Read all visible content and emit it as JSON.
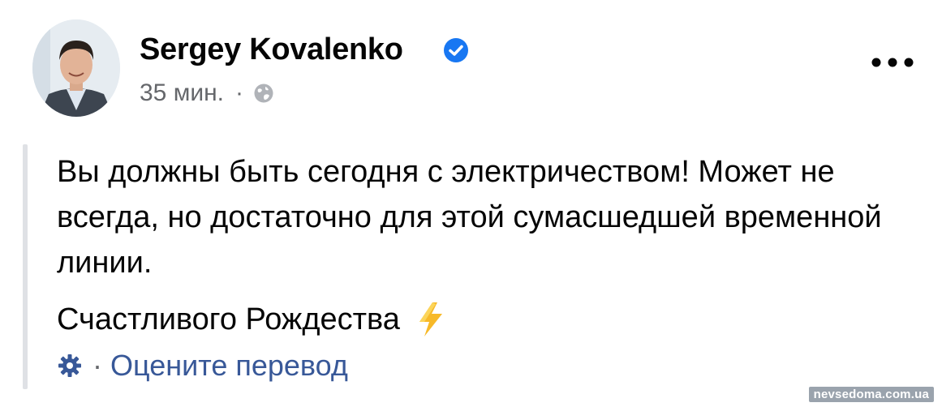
{
  "post": {
    "author": {
      "name": "Sergey Kovalenko",
      "verified": true
    },
    "timestamp": "35 мин.",
    "meta_separator": "·",
    "audience_icon": "globe-icon",
    "more_icon": "more-horizontal-icon",
    "body": {
      "paragraph_1": "Вы должны быть сегодня с электричеством! Может не всегда, но достаточно для этой сумасшедшей временной линии.",
      "paragraph_2": "Счастливого Рождества",
      "emoji": "lightning-bolt-icon"
    },
    "translation": {
      "icon": "gear-icon",
      "separator": "·",
      "rate_label": "Оцените перевод"
    }
  },
  "watermark": "nevsedoma.com.ua",
  "colors": {
    "text_primary": "#050505",
    "text_secondary": "#65676b",
    "link": "#385898",
    "verified_badge": "#1877f2",
    "quote_bar": "#dfe1e5",
    "bolt": "#f7b928"
  }
}
